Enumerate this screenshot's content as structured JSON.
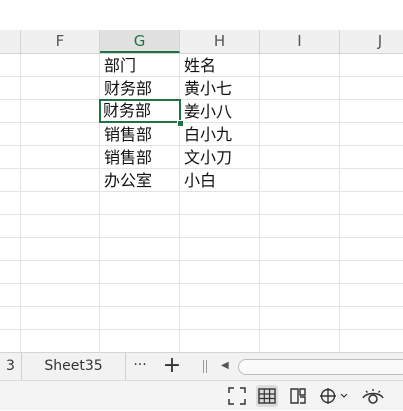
{
  "columns": [
    "F",
    "G",
    "H",
    "I",
    "J"
  ],
  "active_column": "G",
  "cells": {
    "G": [
      "部门",
      "财务部",
      "财务部",
      "销售部",
      "销售部",
      "办公室"
    ],
    "H": [
      "姓名",
      "黄小七",
      "姜小八",
      "白小九",
      "文小刀",
      "小白"
    ]
  },
  "selected_cell": "G3",
  "sheet_tabs": [
    "3",
    "Sheet35"
  ],
  "tab_controls": {
    "more": "···",
    "add": "+"
  },
  "colors": {
    "accent": "#217346",
    "grid": "#e3e3e3",
    "header_bg": "#f0f0f0"
  },
  "status_icons": [
    "fullscreen-icon",
    "normal-view-icon",
    "page-break-view-icon",
    "freeze-pane-icon",
    "eye-protection-icon"
  ]
}
